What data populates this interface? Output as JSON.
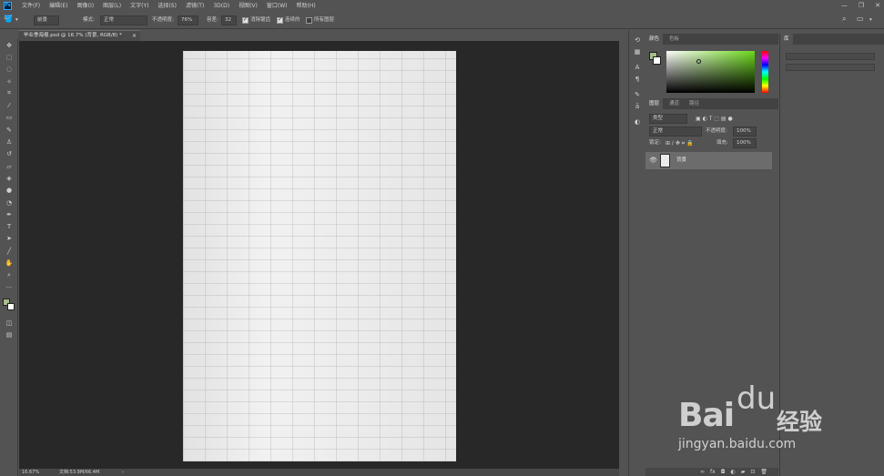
{
  "menubar": {
    "logo": "Ps",
    "items": [
      "文件(F)",
      "编辑(E)",
      "图像(I)",
      "图层(L)",
      "文字(Y)",
      "选择(S)",
      "滤镜(T)",
      "3D(D)",
      "视图(V)",
      "窗口(W)",
      "帮助(H)"
    ],
    "window_controls": [
      "—",
      "❐",
      "✕"
    ]
  },
  "options_bar": {
    "tool_dropdown": "前景",
    "mode_label": "模式:",
    "mode_value": "正常",
    "opacity_label": "不透明度:",
    "opacity_value": "76%",
    "tolerance_label": "容差:",
    "tolerance_value": "32",
    "anti_alias_label": "消除锯齿",
    "contiguous_label": "连续的",
    "all_layers_label": "所有图层",
    "anti_alias_checked": true,
    "contiguous_checked": true,
    "all_layers_checked": false
  },
  "document_tab": {
    "title": "毕业季海报.psd @ 16.7% (背景, RGB/8) *",
    "close": "×"
  },
  "status_bar": {
    "zoom": "16.67%",
    "doc_info": "文档:53.9M/66.4M",
    "arrow": "›"
  },
  "color_panel": {
    "tabs": [
      "颜色",
      "色板"
    ],
    "foreground": "#a7bd8c",
    "background": "#ffffff"
  },
  "layers_panel": {
    "tabs": [
      "图层",
      "通道",
      "路径"
    ],
    "kind_label": "类型",
    "blend_mode": "正常",
    "opacity_label": "不透明度:",
    "opacity_value": "100%",
    "lock_label": "锁定:",
    "fill_label": "填充:",
    "fill_value": "100%",
    "layers": [
      {
        "name": "背景",
        "visible": true
      }
    ]
  },
  "libraries_panel": {
    "tab": "库"
  },
  "watermark": {
    "logo": "Bai",
    "paw": "du",
    "cn": "经验",
    "url": "jingyan.baidu.com"
  }
}
